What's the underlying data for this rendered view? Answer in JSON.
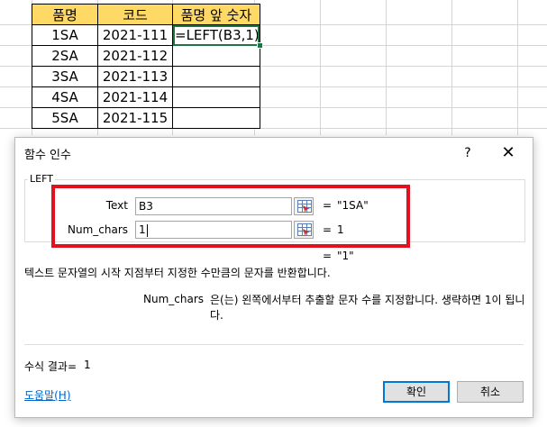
{
  "sheet": {
    "headers": [
      "품명",
      "코드",
      "품명 앞 숫자"
    ],
    "rows": [
      [
        "1SA",
        "2021-111",
        "=LEFT(B3,1)"
      ],
      [
        "2SA",
        "2021-112",
        ""
      ],
      [
        "3SA",
        "2021-113",
        ""
      ],
      [
        "4SA",
        "2021-114",
        ""
      ],
      [
        "5SA",
        "2021-115",
        ""
      ]
    ],
    "header_color": "#ffd966",
    "active_cell_color": "#217346"
  },
  "dialog": {
    "title": "함수 인수",
    "help_icon_label": "?",
    "close_icon_label": "✕",
    "function_name": "LEFT",
    "args": [
      {
        "label": "Text",
        "value": "B3",
        "result": "\"1SA\""
      },
      {
        "label": "Num_chars",
        "value": "1",
        "result": "1"
      }
    ],
    "equals": "=",
    "function_result": "\"1\"",
    "description": "텍스트 문자열의 시작 지점부터 지정한 수만큼의 문자를 반환합니다.",
    "arg_desc_name": "Num_chars",
    "arg_desc_text": "은(는) 왼쪽에서부터 추출할 문자 수를 지정합니다. 생략하면 1이 됩니다.",
    "formula_result_label": "수식 결과=",
    "formula_result_value": "1",
    "help_link": "도움말(H)",
    "ok_label": "확인",
    "cancel_label": "취소",
    "highlight_color": "#e3111d"
  }
}
